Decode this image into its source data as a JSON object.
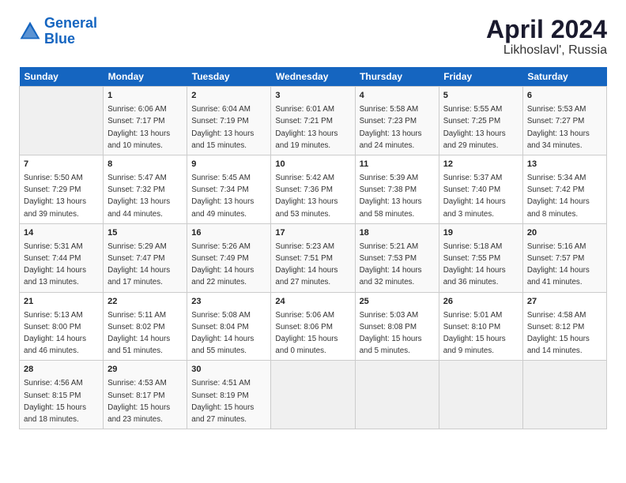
{
  "header": {
    "logo_line1": "General",
    "logo_line2": "Blue",
    "title": "April 2024",
    "subtitle": "Likhoslavl', Russia"
  },
  "weekdays": [
    "Sunday",
    "Monday",
    "Tuesday",
    "Wednesday",
    "Thursday",
    "Friday",
    "Saturday"
  ],
  "weeks": [
    [
      {
        "day": "",
        "info": ""
      },
      {
        "day": "1",
        "info": "Sunrise: 6:06 AM\nSunset: 7:17 PM\nDaylight: 13 hours\nand 10 minutes."
      },
      {
        "day": "2",
        "info": "Sunrise: 6:04 AM\nSunset: 7:19 PM\nDaylight: 13 hours\nand 15 minutes."
      },
      {
        "day": "3",
        "info": "Sunrise: 6:01 AM\nSunset: 7:21 PM\nDaylight: 13 hours\nand 19 minutes."
      },
      {
        "day": "4",
        "info": "Sunrise: 5:58 AM\nSunset: 7:23 PM\nDaylight: 13 hours\nand 24 minutes."
      },
      {
        "day": "5",
        "info": "Sunrise: 5:55 AM\nSunset: 7:25 PM\nDaylight: 13 hours\nand 29 minutes."
      },
      {
        "day": "6",
        "info": "Sunrise: 5:53 AM\nSunset: 7:27 PM\nDaylight: 13 hours\nand 34 minutes."
      }
    ],
    [
      {
        "day": "7",
        "info": "Sunrise: 5:50 AM\nSunset: 7:29 PM\nDaylight: 13 hours\nand 39 minutes."
      },
      {
        "day": "8",
        "info": "Sunrise: 5:47 AM\nSunset: 7:32 PM\nDaylight: 13 hours\nand 44 minutes."
      },
      {
        "day": "9",
        "info": "Sunrise: 5:45 AM\nSunset: 7:34 PM\nDaylight: 13 hours\nand 49 minutes."
      },
      {
        "day": "10",
        "info": "Sunrise: 5:42 AM\nSunset: 7:36 PM\nDaylight: 13 hours\nand 53 minutes."
      },
      {
        "day": "11",
        "info": "Sunrise: 5:39 AM\nSunset: 7:38 PM\nDaylight: 13 hours\nand 58 minutes."
      },
      {
        "day": "12",
        "info": "Sunrise: 5:37 AM\nSunset: 7:40 PM\nDaylight: 14 hours\nand 3 minutes."
      },
      {
        "day": "13",
        "info": "Sunrise: 5:34 AM\nSunset: 7:42 PM\nDaylight: 14 hours\nand 8 minutes."
      }
    ],
    [
      {
        "day": "14",
        "info": "Sunrise: 5:31 AM\nSunset: 7:44 PM\nDaylight: 14 hours\nand 13 minutes."
      },
      {
        "day": "15",
        "info": "Sunrise: 5:29 AM\nSunset: 7:47 PM\nDaylight: 14 hours\nand 17 minutes."
      },
      {
        "day": "16",
        "info": "Sunrise: 5:26 AM\nSunset: 7:49 PM\nDaylight: 14 hours\nand 22 minutes."
      },
      {
        "day": "17",
        "info": "Sunrise: 5:23 AM\nSunset: 7:51 PM\nDaylight: 14 hours\nand 27 minutes."
      },
      {
        "day": "18",
        "info": "Sunrise: 5:21 AM\nSunset: 7:53 PM\nDaylight: 14 hours\nand 32 minutes."
      },
      {
        "day": "19",
        "info": "Sunrise: 5:18 AM\nSunset: 7:55 PM\nDaylight: 14 hours\nand 36 minutes."
      },
      {
        "day": "20",
        "info": "Sunrise: 5:16 AM\nSunset: 7:57 PM\nDaylight: 14 hours\nand 41 minutes."
      }
    ],
    [
      {
        "day": "21",
        "info": "Sunrise: 5:13 AM\nSunset: 8:00 PM\nDaylight: 14 hours\nand 46 minutes."
      },
      {
        "day": "22",
        "info": "Sunrise: 5:11 AM\nSunset: 8:02 PM\nDaylight: 14 hours\nand 51 minutes."
      },
      {
        "day": "23",
        "info": "Sunrise: 5:08 AM\nSunset: 8:04 PM\nDaylight: 14 hours\nand 55 minutes."
      },
      {
        "day": "24",
        "info": "Sunrise: 5:06 AM\nSunset: 8:06 PM\nDaylight: 15 hours\nand 0 minutes."
      },
      {
        "day": "25",
        "info": "Sunrise: 5:03 AM\nSunset: 8:08 PM\nDaylight: 15 hours\nand 5 minutes."
      },
      {
        "day": "26",
        "info": "Sunrise: 5:01 AM\nSunset: 8:10 PM\nDaylight: 15 hours\nand 9 minutes."
      },
      {
        "day": "27",
        "info": "Sunrise: 4:58 AM\nSunset: 8:12 PM\nDaylight: 15 hours\nand 14 minutes."
      }
    ],
    [
      {
        "day": "28",
        "info": "Sunrise: 4:56 AM\nSunset: 8:15 PM\nDaylight: 15 hours\nand 18 minutes."
      },
      {
        "day": "29",
        "info": "Sunrise: 4:53 AM\nSunset: 8:17 PM\nDaylight: 15 hours\nand 23 minutes."
      },
      {
        "day": "30",
        "info": "Sunrise: 4:51 AM\nSunset: 8:19 PM\nDaylight: 15 hours\nand 27 minutes."
      },
      {
        "day": "",
        "info": ""
      },
      {
        "day": "",
        "info": ""
      },
      {
        "day": "",
        "info": ""
      },
      {
        "day": "",
        "info": ""
      }
    ]
  ]
}
